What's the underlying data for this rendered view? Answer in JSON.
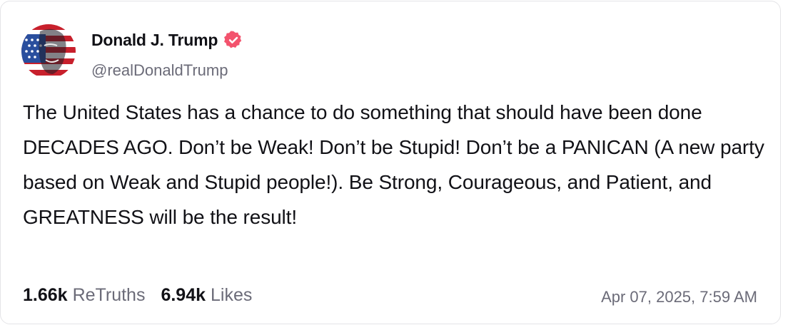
{
  "author": {
    "display_name": "Donald J. Trump",
    "handle": "@realDonaldTrump",
    "verified_badge_icon": "verified-badge-icon",
    "verified_color": "#f3536d"
  },
  "post": {
    "text": "The United States has a chance to do something that should have been done DECADES AGO. Don’t be Weak! Don’t be Stupid! Don’t be a PANICAN (A new party based on Weak and Stupid people!). Be Strong, Courageous, and Patient, and GREATNESS will be the result!"
  },
  "stats": {
    "retruths_value": "1.66k",
    "retruths_label": "ReTruths",
    "likes_value": "6.94k",
    "likes_label": "Likes"
  },
  "timestamp": "Apr 07, 2025, 7:59 AM"
}
